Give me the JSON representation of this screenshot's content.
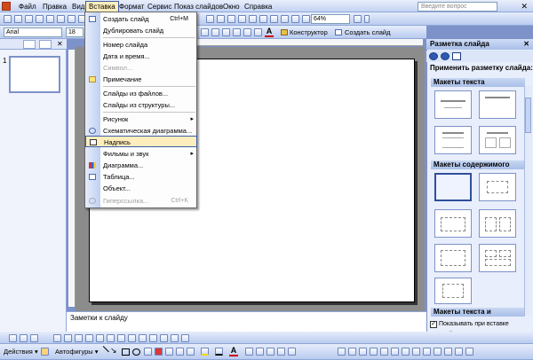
{
  "menubar": {
    "items": [
      "Файл",
      "Правка",
      "Вид",
      "Вставка",
      "Формат",
      "Сервис",
      "Показ слайдов",
      "Окно",
      "Справка"
    ],
    "help_placeholder": "Введите вопрос"
  },
  "toolbar": {
    "zoom": "64%",
    "font_name": "Arial",
    "font_size": "18",
    "designer_label": "Конструктор",
    "new_slide_label": "Создать слайд"
  },
  "insert_menu": {
    "items": [
      {
        "label": "Создать слайд",
        "shortcut": "Ctrl+M"
      },
      {
        "label": "Дублировать слайд"
      },
      {
        "label": "Номер слайда"
      },
      {
        "label": "Дата и время..."
      },
      {
        "label": "Символ...",
        "disabled": true
      },
      {
        "label": "Примечание"
      },
      {
        "label": "Слайды из файлов..."
      },
      {
        "label": "Слайды из структуры..."
      },
      {
        "label": "Рисунок",
        "submenu": true
      },
      {
        "label": "Схематическая диаграмма..."
      },
      {
        "label": "Надпись",
        "highlighted": true
      },
      {
        "label": "Фильмы и звук",
        "submenu": true
      },
      {
        "label": "Диаграмма..."
      },
      {
        "label": "Таблица..."
      },
      {
        "label": "Объект..."
      },
      {
        "label": "Гиперссылка...",
        "shortcut": "Ctrl+K",
        "disabled": true
      }
    ],
    "submenu_arrow": "▸"
  },
  "slides_pane": {
    "slide_number": "1"
  },
  "notes": {
    "placeholder": "Заметки к слайду"
  },
  "task_pane": {
    "title": "Разметка слайда",
    "apply_label": "Применить разметку слайда:",
    "sections": [
      "Макеты текста",
      "Макеты содержимого",
      "Макеты текста и"
    ],
    "show_on_insert_label": "Показывать при вставке слайдов",
    "show_on_insert_checked": true
  },
  "drawing_toolbar": {
    "actions_label": "Действия",
    "autoshapes_label": "Автофигуры"
  },
  "colors": {
    "accent": "#ffeebd",
    "bar": "#c3d3f3",
    "workspace": "#8c8c8c"
  }
}
